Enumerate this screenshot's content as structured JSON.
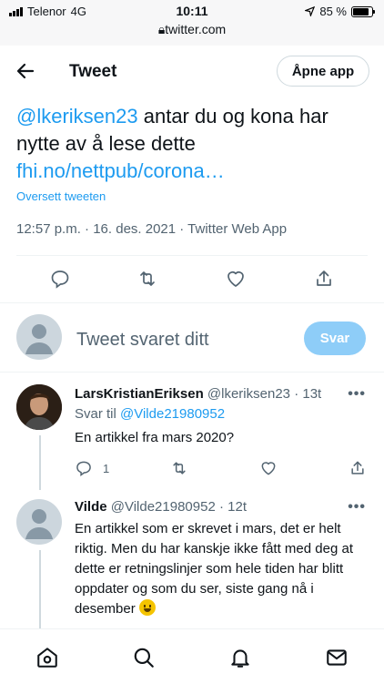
{
  "status": {
    "carrier": "Telenor",
    "network": "4G",
    "time": "10:11",
    "url": "twitter.com",
    "battery": "85 %",
    "battery_level": 0.85
  },
  "header": {
    "title": "Tweet",
    "open_app": "Åpne app"
  },
  "tweet": {
    "mention": "@lkeriksen23",
    "text": " antar du og kona har nytte av å lese dette",
    "link": "fhi.no/nettpub/corona…",
    "translate": "Oversett tweeten",
    "meta": "12:57 p.m. · 16. des. 2021 · Twitter Web App"
  },
  "composer": {
    "placeholder": "Tweet svaret ditt",
    "button": "Svar"
  },
  "replies": [
    {
      "name": "LarsKristianEriksen",
      "handle": "@lkeriksen23",
      "time": "· 13t",
      "reply_to_label": "Svar til ",
      "reply_to": "@Vilde21980952",
      "text": "En artikkel fra mars 2020?",
      "reply_count": "1"
    },
    {
      "name": "Vilde",
      "handle": "@Vilde21980952",
      "time": "· 12t",
      "text": "En artikkel som er skrevet i mars, det er helt riktig. Men du har kanskje ikke fått med deg at dette er retningslinjer som hele tiden har blitt oppdater og som du ser, siste gang nå i desember"
    }
  ],
  "more_label": "•••"
}
